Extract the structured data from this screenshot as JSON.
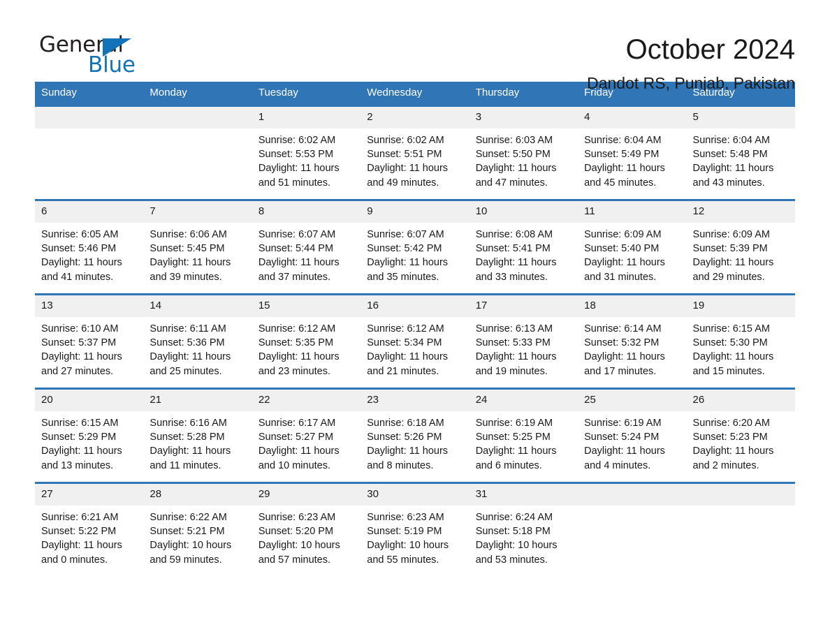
{
  "logo": {
    "word_black": "General",
    "word_blue": "Blue",
    "triangle_color": "#1273b8"
  },
  "header": {
    "month_title": "October 2024",
    "location": "Dandot RS, Punjab, Pakistan"
  },
  "theme": {
    "header_blue": "#3075b5",
    "daynum_band": "#f0f0f0",
    "text": "#1a1a1a"
  },
  "calendar": {
    "weekday_headers": [
      "Sunday",
      "Monday",
      "Tuesday",
      "Wednesday",
      "Thursday",
      "Friday",
      "Saturday"
    ],
    "weeks": [
      [
        {
          "day": "",
          "sunrise": "",
          "sunset": "",
          "daylight": "",
          "empty": true
        },
        {
          "day": "",
          "sunrise": "",
          "sunset": "",
          "daylight": "",
          "empty": true
        },
        {
          "day": "1",
          "sunrise": "Sunrise: 6:02 AM",
          "sunset": "Sunset: 5:53 PM",
          "daylight": "Daylight: 11 hours and 51 minutes."
        },
        {
          "day": "2",
          "sunrise": "Sunrise: 6:02 AM",
          "sunset": "Sunset: 5:51 PM",
          "daylight": "Daylight: 11 hours and 49 minutes."
        },
        {
          "day": "3",
          "sunrise": "Sunrise: 6:03 AM",
          "sunset": "Sunset: 5:50 PM",
          "daylight": "Daylight: 11 hours and 47 minutes."
        },
        {
          "day": "4",
          "sunrise": "Sunrise: 6:04 AM",
          "sunset": "Sunset: 5:49 PM",
          "daylight": "Daylight: 11 hours and 45 minutes."
        },
        {
          "day": "5",
          "sunrise": "Sunrise: 6:04 AM",
          "sunset": "Sunset: 5:48 PM",
          "daylight": "Daylight: 11 hours and 43 minutes."
        }
      ],
      [
        {
          "day": "6",
          "sunrise": "Sunrise: 6:05 AM",
          "sunset": "Sunset: 5:46 PM",
          "daylight": "Daylight: 11 hours and 41 minutes."
        },
        {
          "day": "7",
          "sunrise": "Sunrise: 6:06 AM",
          "sunset": "Sunset: 5:45 PM",
          "daylight": "Daylight: 11 hours and 39 minutes."
        },
        {
          "day": "8",
          "sunrise": "Sunrise: 6:07 AM",
          "sunset": "Sunset: 5:44 PM",
          "daylight": "Daylight: 11 hours and 37 minutes."
        },
        {
          "day": "9",
          "sunrise": "Sunrise: 6:07 AM",
          "sunset": "Sunset: 5:42 PM",
          "daylight": "Daylight: 11 hours and 35 minutes."
        },
        {
          "day": "10",
          "sunrise": "Sunrise: 6:08 AM",
          "sunset": "Sunset: 5:41 PM",
          "daylight": "Daylight: 11 hours and 33 minutes."
        },
        {
          "day": "11",
          "sunrise": "Sunrise: 6:09 AM",
          "sunset": "Sunset: 5:40 PM",
          "daylight": "Daylight: 11 hours and 31 minutes."
        },
        {
          "day": "12",
          "sunrise": "Sunrise: 6:09 AM",
          "sunset": "Sunset: 5:39 PM",
          "daylight": "Daylight: 11 hours and 29 minutes."
        }
      ],
      [
        {
          "day": "13",
          "sunrise": "Sunrise: 6:10 AM",
          "sunset": "Sunset: 5:37 PM",
          "daylight": "Daylight: 11 hours and 27 minutes."
        },
        {
          "day": "14",
          "sunrise": "Sunrise: 6:11 AM",
          "sunset": "Sunset: 5:36 PM",
          "daylight": "Daylight: 11 hours and 25 minutes."
        },
        {
          "day": "15",
          "sunrise": "Sunrise: 6:12 AM",
          "sunset": "Sunset: 5:35 PM",
          "daylight": "Daylight: 11 hours and 23 minutes."
        },
        {
          "day": "16",
          "sunrise": "Sunrise: 6:12 AM",
          "sunset": "Sunset: 5:34 PM",
          "daylight": "Daylight: 11 hours and 21 minutes."
        },
        {
          "day": "17",
          "sunrise": "Sunrise: 6:13 AM",
          "sunset": "Sunset: 5:33 PM",
          "daylight": "Daylight: 11 hours and 19 minutes."
        },
        {
          "day": "18",
          "sunrise": "Sunrise: 6:14 AM",
          "sunset": "Sunset: 5:32 PM",
          "daylight": "Daylight: 11 hours and 17 minutes."
        },
        {
          "day": "19",
          "sunrise": "Sunrise: 6:15 AM",
          "sunset": "Sunset: 5:30 PM",
          "daylight": "Daylight: 11 hours and 15 minutes."
        }
      ],
      [
        {
          "day": "20",
          "sunrise": "Sunrise: 6:15 AM",
          "sunset": "Sunset: 5:29 PM",
          "daylight": "Daylight: 11 hours and 13 minutes."
        },
        {
          "day": "21",
          "sunrise": "Sunrise: 6:16 AM",
          "sunset": "Sunset: 5:28 PM",
          "daylight": "Daylight: 11 hours and 11 minutes."
        },
        {
          "day": "22",
          "sunrise": "Sunrise: 6:17 AM",
          "sunset": "Sunset: 5:27 PM",
          "daylight": "Daylight: 11 hours and 10 minutes."
        },
        {
          "day": "23",
          "sunrise": "Sunrise: 6:18 AM",
          "sunset": "Sunset: 5:26 PM",
          "daylight": "Daylight: 11 hours and 8 minutes."
        },
        {
          "day": "24",
          "sunrise": "Sunrise: 6:19 AM",
          "sunset": "Sunset: 5:25 PM",
          "daylight": "Daylight: 11 hours and 6 minutes."
        },
        {
          "day": "25",
          "sunrise": "Sunrise: 6:19 AM",
          "sunset": "Sunset: 5:24 PM",
          "daylight": "Daylight: 11 hours and 4 minutes."
        },
        {
          "day": "26",
          "sunrise": "Sunrise: 6:20 AM",
          "sunset": "Sunset: 5:23 PM",
          "daylight": "Daylight: 11 hours and 2 minutes."
        }
      ],
      [
        {
          "day": "27",
          "sunrise": "Sunrise: 6:21 AM",
          "sunset": "Sunset: 5:22 PM",
          "daylight": "Daylight: 11 hours and 0 minutes."
        },
        {
          "day": "28",
          "sunrise": "Sunrise: 6:22 AM",
          "sunset": "Sunset: 5:21 PM",
          "daylight": "Daylight: 10 hours and 59 minutes."
        },
        {
          "day": "29",
          "sunrise": "Sunrise: 6:23 AM",
          "sunset": "Sunset: 5:20 PM",
          "daylight": "Daylight: 10 hours and 57 minutes."
        },
        {
          "day": "30",
          "sunrise": "Sunrise: 6:23 AM",
          "sunset": "Sunset: 5:19 PM",
          "daylight": "Daylight: 10 hours and 55 minutes."
        },
        {
          "day": "31",
          "sunrise": "Sunrise: 6:24 AM",
          "sunset": "Sunset: 5:18 PM",
          "daylight": "Daylight: 10 hours and 53 minutes."
        },
        {
          "day": "",
          "sunrise": "",
          "sunset": "",
          "daylight": "",
          "empty": true
        },
        {
          "day": "",
          "sunrise": "",
          "sunset": "",
          "daylight": "",
          "empty": true
        }
      ]
    ]
  }
}
